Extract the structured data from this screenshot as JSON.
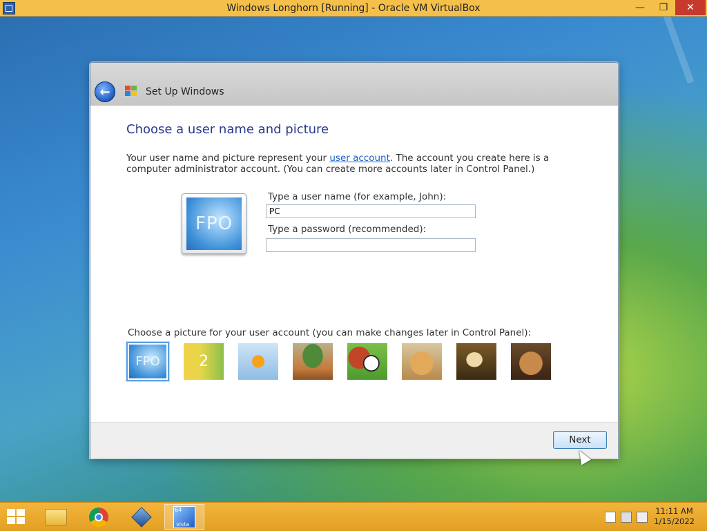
{
  "host": {
    "window_title": "Windows Longhorn [Running] - Oracle VM VirtualBox",
    "minimize_label": "—",
    "restore_label": "❐",
    "close_label": "✕"
  },
  "dialog": {
    "header_title": "Set Up Windows",
    "heading": "Choose a user name and picture",
    "description_before_link": "Your user name and picture represent your ",
    "description_link": "user account",
    "description_after_link": ". The account you create here is a computer administrator account. (You can create more accounts later in Control Panel.)",
    "big_picture_text": "FPO",
    "username_label": "Type a user name (for example, John):",
    "username_value": "PC",
    "password_label": "Type a password (recommended):",
    "password_value": "",
    "choose_picture_label": "Choose a picture for your user account (you can make changes later in Control Panel):",
    "pictures": [
      {
        "name": "fpo",
        "text": "FPO",
        "selected": true
      },
      {
        "name": "number-2",
        "text": "2",
        "selected": false
      },
      {
        "name": "goldfish",
        "text": "",
        "selected": false
      },
      {
        "name": "bonsai",
        "text": "",
        "selected": false
      },
      {
        "name": "sports-balls",
        "text": "",
        "selected": false
      },
      {
        "name": "dog",
        "text": "",
        "selected": false
      },
      {
        "name": "chess",
        "text": "",
        "selected": false
      },
      {
        "name": "kitten",
        "text": "",
        "selected": false
      }
    ],
    "next_label": "Next"
  },
  "taskbar": {
    "apps": [
      "file-explorer",
      "chrome",
      "virtualbox",
      "vista-vm"
    ],
    "vm_badge": "64",
    "vm_label": "vista",
    "time": "11:11 AM",
    "date": "1/15/2022"
  },
  "colors": {
    "title_bar": "#f5c04a",
    "heading": "#2a3a8c",
    "link": "#1a5fc9",
    "taskbar": "#e9a92c"
  }
}
